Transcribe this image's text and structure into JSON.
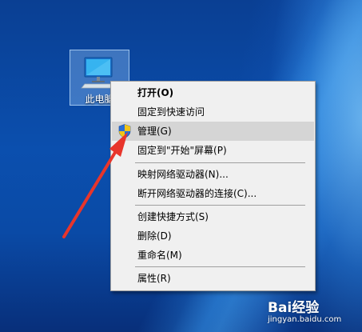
{
  "desktop": {
    "icon_label": "此电脑"
  },
  "menu": {
    "items": [
      {
        "label": "打开(O)",
        "bold": true
      },
      {
        "label": "固定到快速访问"
      },
      {
        "label": "管理(G)",
        "highlighted": true,
        "icon": "uac-shield-icon"
      },
      {
        "label": "固定到\"开始\"屏幕(P)"
      },
      {
        "label": "映射网络驱动器(N)..."
      },
      {
        "label": "断开网络驱动器的连接(C)..."
      },
      {
        "label": "创建快捷方式(S)"
      },
      {
        "label": "删除(D)"
      },
      {
        "label": "重命名(M)"
      },
      {
        "label": "属性(R)"
      }
    ]
  },
  "watermark": {
    "brand": "Bai经验",
    "url": "jingyan.baidu.com"
  },
  "colors": {
    "annotation_arrow": "#e8352b",
    "menu_background": "#f0f0f0",
    "menu_highlight": "#d5d5d5"
  }
}
